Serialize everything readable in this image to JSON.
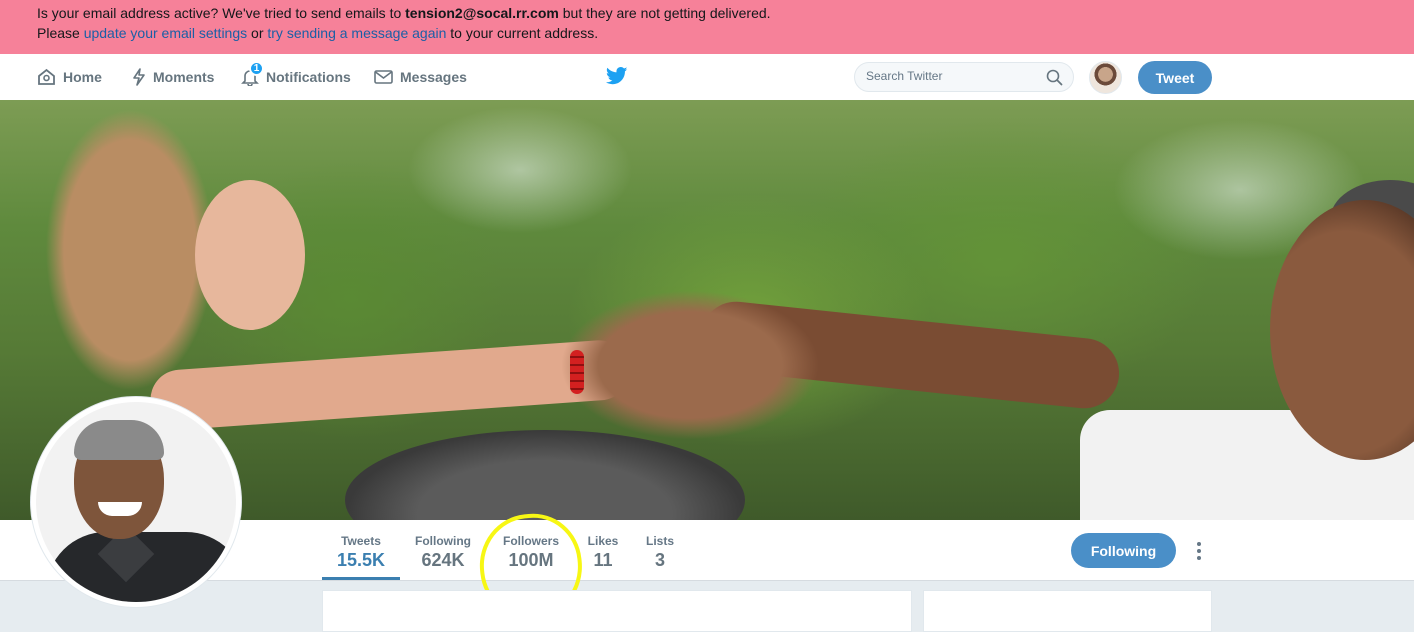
{
  "alert": {
    "line1_prefix": "Is your email address active? We've tried to send emails to ",
    "email": "tension2@socal.rr.com",
    "line1_suffix": " but they are not getting delivered.",
    "line2_prefix": "Please ",
    "link_update": "update your email settings",
    "line2_mid": " or ",
    "link_resend": "try sending a message again",
    "line2_suffix": " to your current address."
  },
  "nav": {
    "home": "Home",
    "moments": "Moments",
    "notifications": "Notifications",
    "notifications_badge": "1",
    "messages": "Messages",
    "search_placeholder": "Search Twitter",
    "tweet_button": "Tweet"
  },
  "profile": {
    "stats": [
      {
        "label": "Tweets",
        "value": "15.5K"
      },
      {
        "label": "Following",
        "value": "624K"
      },
      {
        "label": "Followers",
        "value": "100M"
      },
      {
        "label": "Likes",
        "value": "11"
      },
      {
        "label": "Lists",
        "value": "3"
      }
    ],
    "following_button": "Following"
  },
  "colors": {
    "alert_bg": "#f68199",
    "link": "#1b5fa6",
    "accent_button": "#4a8fc8",
    "twitter_blue": "#1da1f2",
    "annotation": "#f7f714"
  },
  "icons": [
    "home-icon",
    "moments-icon",
    "notifications-icon",
    "messages-icon",
    "twitter-bird-icon",
    "search-icon",
    "more-icon"
  ]
}
